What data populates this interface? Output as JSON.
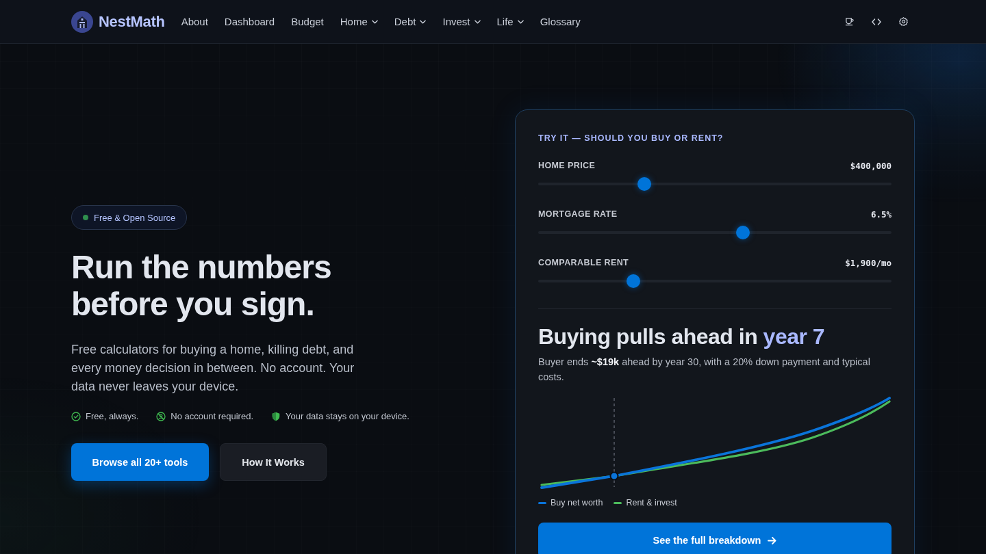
{
  "nav": {
    "brand": "NestMath",
    "links": [
      {
        "label": "About",
        "dropdown": false
      },
      {
        "label": "Dashboard",
        "dropdown": false
      },
      {
        "label": "Budget",
        "dropdown": false
      },
      {
        "label": "Home",
        "dropdown": true
      },
      {
        "label": "Debt",
        "dropdown": true
      },
      {
        "label": "Invest",
        "dropdown": true
      },
      {
        "label": "Life",
        "dropdown": true
      },
      {
        "label": "Glossary",
        "dropdown": false
      }
    ]
  },
  "hero": {
    "badge": "Free & Open Source",
    "headline": "Run the numbers before you sign.",
    "description": "Free calculators for buying a home, killing debt, and every money decision in between. No account. Your data never leaves your device.",
    "features": [
      {
        "label": "Free, always."
      },
      {
        "label": "No account required."
      },
      {
        "label": "Your data stays on your device."
      }
    ],
    "buttons": [
      {
        "label": "Browse all 20+ tools",
        "kind": "primary"
      },
      {
        "label": "How It Works",
        "kind": "secondary"
      }
    ]
  },
  "calculator": {
    "title": "TRY IT — SHOULD YOU BUY OR RENT?",
    "sliders": [
      {
        "label": "HOME PRICE",
        "value": "$400,000",
        "level": 0.3
      },
      {
        "label": "MORTGAGE RATE",
        "value": "6.5%",
        "level": 0.58
      },
      {
        "label": "COMPARABLE RENT",
        "value": "$1,900/mo",
        "level": 0.27
      }
    ],
    "result": {
      "heading": "Buying pulls ahead in",
      "highlight": "year 7",
      "summary": "Buyer ends **~$19k** ahead by year 30, with a 20% down payment and typical costs."
    },
    "legend": [
      {
        "label": "Buy net worth",
        "color": "#0a74da"
      },
      {
        "label": "Rent & invest",
        "color": "#4cbb5c"
      }
    ],
    "cta": "See the full breakdown"
  }
}
